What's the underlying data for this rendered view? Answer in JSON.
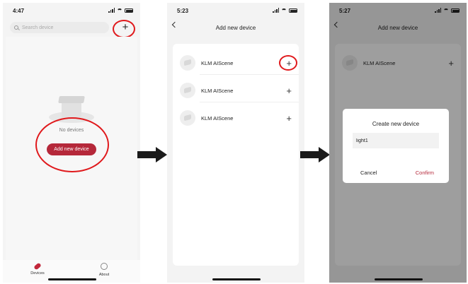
{
  "screen1": {
    "time": "4:47",
    "search_placeholder": "Search device",
    "add_icon": "+",
    "empty_text": "No devices",
    "add_button_label": "Add new device",
    "tabs": [
      {
        "label": "Devices",
        "icon": "pill-icon",
        "active": true
      },
      {
        "label": "About",
        "icon": "info-gear-icon",
        "active": false
      }
    ]
  },
  "screen2": {
    "time": "5:23",
    "title": "Add new device",
    "devices": [
      {
        "name": "KLM AIScene",
        "action": "+"
      },
      {
        "name": "KLM AIScene",
        "action": "+"
      },
      {
        "name": "KLM AIScene",
        "action": "+"
      }
    ]
  },
  "screen3": {
    "time": "5:27",
    "title": "Add new device",
    "device": {
      "name": "KLM AIScene",
      "action": "+"
    },
    "dialog": {
      "title": "Create new device",
      "input_value": "light1",
      "cancel_label": "Cancel",
      "confirm_label": "Confirm"
    }
  },
  "colors": {
    "accent": "#b5283a",
    "highlight_circle": "#e0191c",
    "arrow": "#1a1a1a"
  }
}
